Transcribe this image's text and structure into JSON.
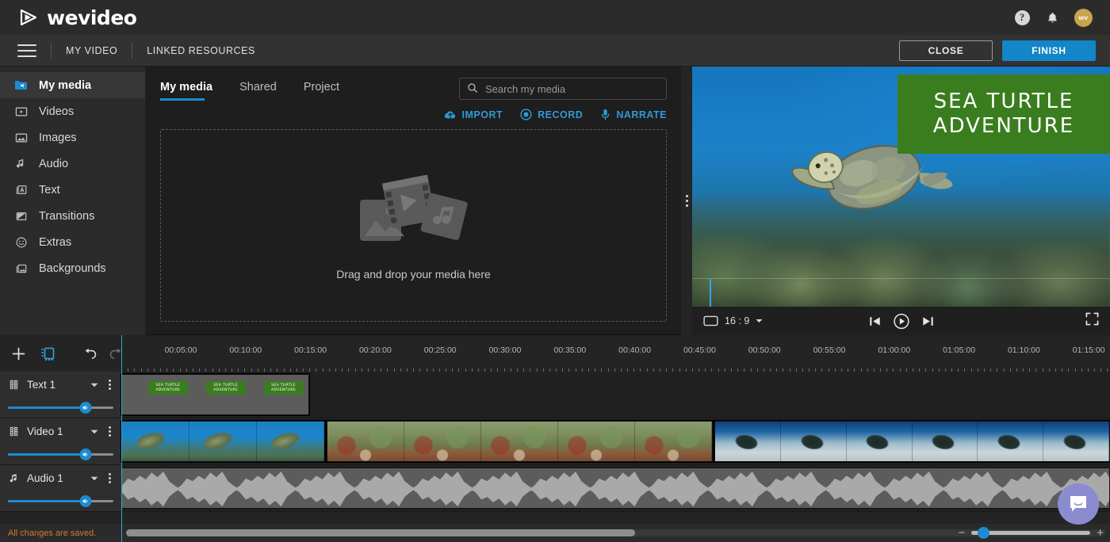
{
  "topbar": {
    "brand": "wevideo",
    "logo_icon": "play-triangle-icon",
    "help_label": "?",
    "help_icon": "help-circle-icon",
    "bell_icon": "notification-bell-icon",
    "avatar_initials": "wv"
  },
  "subbar": {
    "menu_icon": "hamburger-menu-icon",
    "nav": [
      {
        "label": "MY VIDEO"
      },
      {
        "label": "LINKED RESOURCES"
      }
    ],
    "close_label": "CLOSE",
    "finish_label": "FINISH",
    "finish_color": "#1386c8"
  },
  "sidebar": {
    "items": [
      {
        "label": "My media",
        "icon": "folder-media-icon",
        "active": true
      },
      {
        "label": "Videos",
        "icon": "video-play-icon",
        "active": false
      },
      {
        "label": "Images",
        "icon": "image-icon",
        "active": false
      },
      {
        "label": "Audio",
        "icon": "music-note-icon",
        "active": false
      },
      {
        "label": "Text",
        "icon": "text-letter-icon",
        "active": false
      },
      {
        "label": "Transitions",
        "icon": "transition-icon",
        "active": false
      },
      {
        "label": "Extras",
        "icon": "smiley-face-icon",
        "active": false
      },
      {
        "label": "Backgrounds",
        "icon": "backgrounds-icon",
        "active": false
      }
    ]
  },
  "media_panel": {
    "tabs": [
      {
        "label": "My media",
        "active": true
      },
      {
        "label": "Shared",
        "active": false
      },
      {
        "label": "Project",
        "active": false
      }
    ],
    "search": {
      "placeholder": "Search my media",
      "value": "",
      "icon": "search-icon"
    },
    "actions": [
      {
        "label": "IMPORT",
        "icon": "cloud-upload-icon"
      },
      {
        "label": "RECORD",
        "icon": "record-circle-icon"
      },
      {
        "label": "NARRATE",
        "icon": "microphone-icon"
      }
    ],
    "dropzone_text": "Drag and drop your media here",
    "dropzone_icon": "media-stack-icon",
    "accent_color": "#2e9ad6"
  },
  "preview": {
    "title_card": {
      "line1": "SEA TURTLE",
      "line2": "ADVENTURE",
      "background": "#3a7d1e"
    },
    "aspect_ratio": "16 : 9",
    "aspect_icon": "screen-icon",
    "controls": [
      {
        "name": "skip-previous",
        "icon": "skip-previous-icon"
      },
      {
        "name": "play",
        "icon": "play-circle-icon"
      },
      {
        "name": "skip-next",
        "icon": "skip-next-icon"
      }
    ],
    "fullscreen_icon": "fullscreen-icon",
    "drag_handle_icon": "vertical-drag-handle-icon"
  },
  "timeline": {
    "tools": [
      {
        "name": "add-track",
        "label": "+",
        "icon": "plus-icon"
      },
      {
        "name": "split-clip",
        "label": "",
        "icon": "duplicate-frame-icon"
      },
      {
        "name": "undo",
        "label": "",
        "icon": "undo-arrow-icon"
      },
      {
        "name": "redo",
        "label": "",
        "icon": "redo-arrow-icon"
      }
    ],
    "ruler_labels": [
      "00:05:00",
      "00:10:00",
      "00:15:00",
      "00:20:00",
      "00:25:00",
      "00:30:00",
      "00:35:00",
      "00:40:00",
      "00:45:00",
      "00:50:00",
      "00:55:00",
      "01:00:00",
      "01:05:00",
      "01:10:00",
      "01:15:00"
    ],
    "tracks": [
      {
        "name": "Text 1",
        "icon": "film-strip-icon",
        "volume_percent": 74,
        "type": "text",
        "clips": [
          {
            "left_pct": 0.0,
            "width_pct": 19.0,
            "titles": 3
          }
        ]
      },
      {
        "name": "Video 1",
        "icon": "film-strip-icon",
        "volume_percent": 74,
        "type": "video",
        "clips": [
          {
            "left_pct": 0.0,
            "width_pct": 20.6,
            "thumbs": [
              "blue",
              "blue",
              "blue"
            ]
          },
          {
            "left_pct": 20.8,
            "width_pct": 39.0,
            "thumbs": [
              "reef",
              "reef",
              "reef",
              "reef",
              "reef"
            ]
          },
          {
            "left_pct": 60.0,
            "width_pct": 40.0,
            "thumbs": [
              "sand",
              "sand",
              "sand",
              "sand",
              "sand",
              "sand"
            ]
          }
        ]
      },
      {
        "name": "Audio 1",
        "icon": "music-note-icon",
        "volume_percent": 74,
        "type": "audio",
        "clips": [
          {
            "left_pct": 0.0,
            "width_pct": 100.0
          }
        ]
      }
    ],
    "status_message": "All changes are saved.",
    "scroll_thumb_pct": 52,
    "zoom_value_pct": 5,
    "zoom_minus": "−",
    "zoom_plus": "+",
    "playhead_pct": 0.15
  },
  "intercom": {
    "icon": "chat-bubble-icon",
    "color": "#8b8ccf"
  }
}
